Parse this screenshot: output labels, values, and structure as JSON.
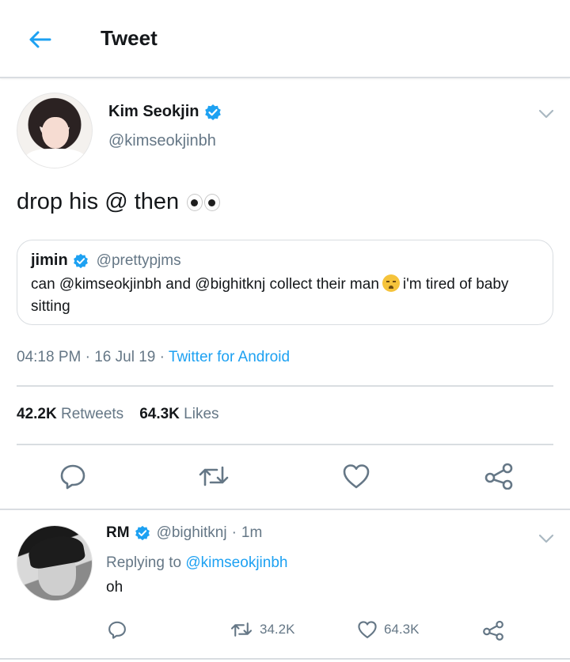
{
  "header": {
    "title": "Tweet"
  },
  "tweet": {
    "author_name": "Kim Seokjin",
    "author_handle": "@kimseokjinbh",
    "text": "drop his @ then",
    "quote": {
      "name": "jimin",
      "handle": "@prettypjms",
      "text_before": "can @kimseokjinbh and @bighitknj collect their man",
      "text_after": "i'm tired of baby sitting"
    },
    "time": "04:18 PM",
    "date": "16 Jul 19",
    "source": "Twitter for Android",
    "retweets_count": "42.2K",
    "retweets_label": "Retweets",
    "likes_count": "64.3K",
    "likes_label": "Likes"
  },
  "reply": {
    "name": "RM",
    "handle": "@bighitknj",
    "age": "1m",
    "replying_prefix": "Replying to",
    "replying_to": "@kimseokjinbh",
    "text": "oh",
    "retweets": "34.2K",
    "likes": "64.3K"
  },
  "colors": {
    "accent": "#1da1f2",
    "secondary_text": "#657786",
    "divider": "#d9dde1"
  },
  "icons": [
    "back-arrow-icon",
    "verified-icon",
    "chevron-down-icon",
    "reply-icon",
    "retweet-icon",
    "heart-icon",
    "share-icon"
  ]
}
